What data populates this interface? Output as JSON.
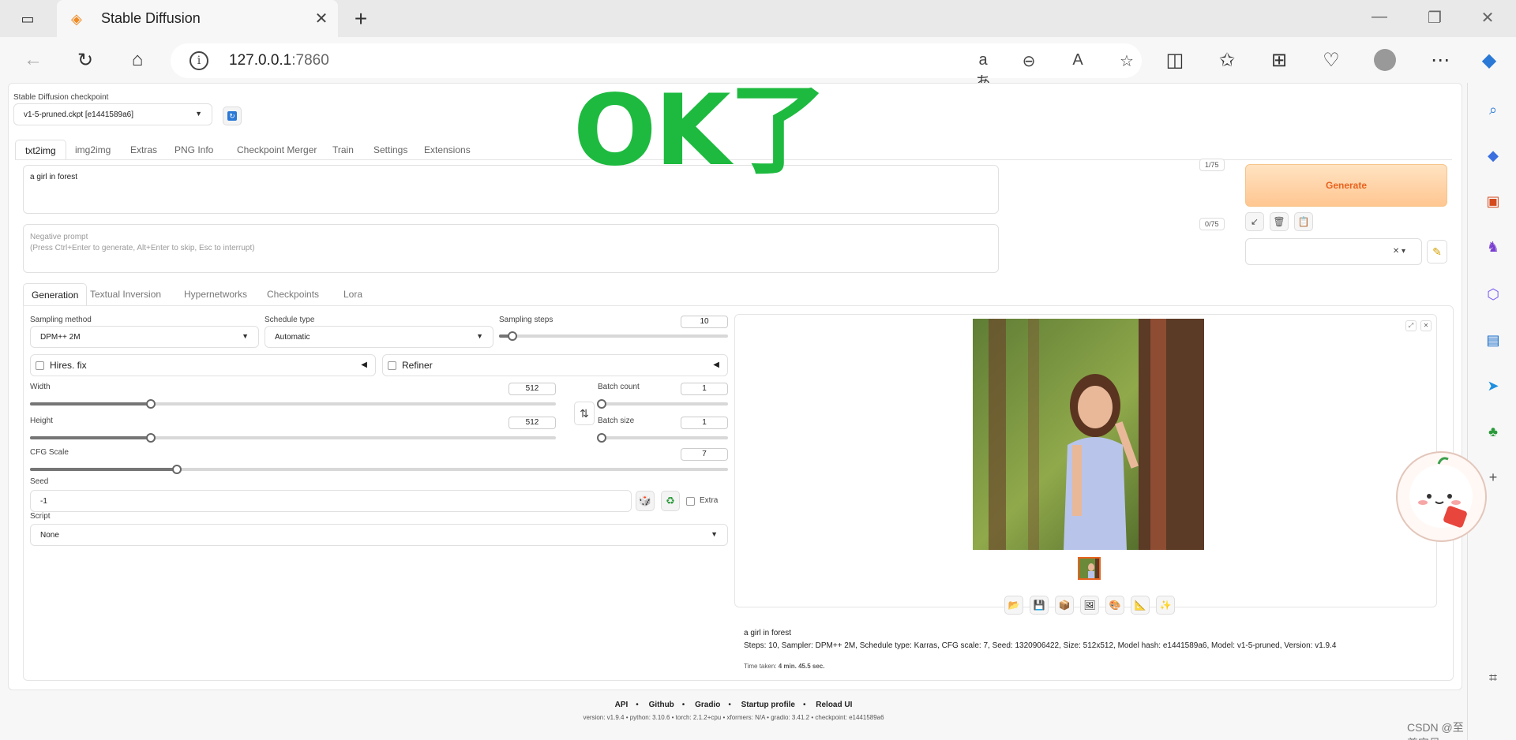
{
  "browser": {
    "tab_title": "Stable Diffusion",
    "url_host": "127.0.0.1",
    "url_port": ":7860",
    "read_aloud_glyph": "aあ"
  },
  "app": {
    "checkpoint_label": "Stable Diffusion checkpoint",
    "checkpoint_value": "v1-5-pruned.ckpt [e1441589a6]",
    "top_tabs": [
      "txt2img",
      "img2img",
      "Extras",
      "PNG Info",
      "Checkpoint Merger",
      "Train",
      "Settings",
      "Extensions"
    ],
    "prompt": {
      "value": "a girl in forest",
      "counter": "1/75"
    },
    "negative_prompt": {
      "placeholder_line1": "Negative prompt",
      "placeholder_line2": "(Press Ctrl+Enter to generate, Alt+Enter to skip, Esc to interrupt)",
      "counter": "0/75"
    },
    "generate_label": "Generate",
    "sub_tabs": [
      "Generation",
      "Textual Inversion",
      "Hypernetworks",
      "Checkpoints",
      "Lora"
    ],
    "sampling_method": {
      "label": "Sampling method",
      "value": "DPM++ 2M"
    },
    "schedule_type": {
      "label": "Schedule type",
      "value": "Automatic"
    },
    "sampling_steps": {
      "label": "Sampling steps",
      "value": "10",
      "fraction": 0.06
    },
    "hires_fix": "Hires. fix",
    "refiner": "Refiner",
    "width": {
      "label": "Width",
      "value": "512",
      "fraction": 0.23
    },
    "height": {
      "label": "Height",
      "value": "512",
      "fraction": 0.23
    },
    "batch_count": {
      "label": "Batch count",
      "value": "1",
      "fraction": 0.0
    },
    "batch_size": {
      "label": "Batch size",
      "value": "1",
      "fraction": 0.0
    },
    "cfg_scale": {
      "label": "CFG Scale",
      "value": "7",
      "fraction": 0.21
    },
    "seed": {
      "label": "Seed",
      "value": "-1",
      "extra": "Extra"
    },
    "script": {
      "label": "Script",
      "value": "None"
    },
    "output": {
      "prompt_text": "a girl in forest",
      "params": "Steps: 10, Sampler: DPM++ 2M, Schedule type: Karras, CFG scale: 7, Seed: 1320906422, Size: 512x512, Model hash: e1441589a6, Model: v1-5-pruned, Version: v1.9.4",
      "time_label": "Time taken:",
      "time_value": "4 min. 45.5 sec."
    }
  },
  "overlay_text": "OK了",
  "footer": {
    "links": [
      "API",
      "Github",
      "Gradio",
      "Startup profile",
      "Reload UI"
    ],
    "version_line": "version: v1.9.4  •  python: 3.10.6  •  torch: 2.1.2+cpu  •  xformers: N/A  •  gradio: 3.41.2  •  checkpoint: e1441589a6"
  },
  "watermark": "CSDN @至尊宝贝",
  "colors": {
    "generate_text": "#e8631f",
    "overlay": "#1dba3f",
    "accent_orange": "#f08a24"
  }
}
